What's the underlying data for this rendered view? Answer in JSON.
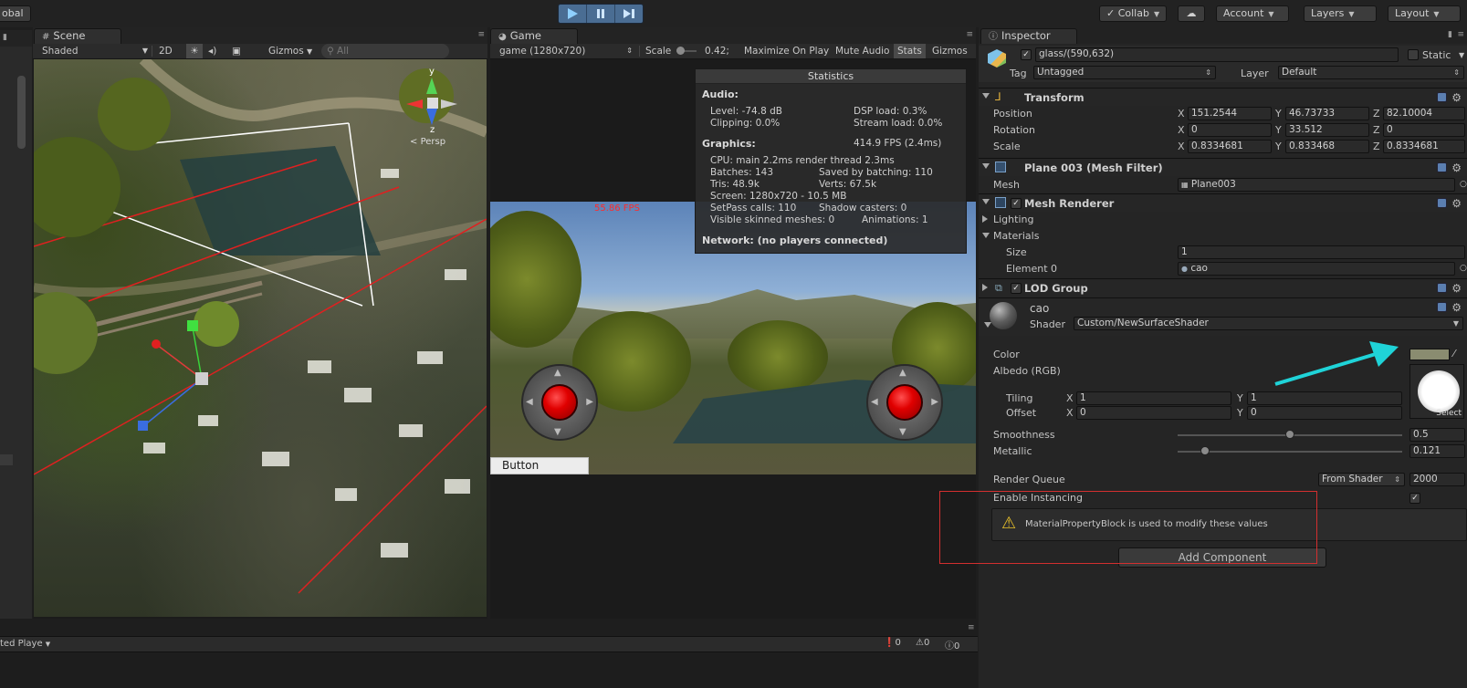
{
  "toolbar": {
    "left_fragment": "obal",
    "collab_label": "Collab",
    "account_label": "Account",
    "layers_label": "Layers",
    "layout_label": "Layout"
  },
  "scene": {
    "tab_label": "Scene",
    "shading_mode": "Shaded",
    "mode_2d": "2D",
    "gizmos_label": "Gizmos",
    "search_placeholder": "All",
    "gizmo_y": "y",
    "gizmo_z": "z",
    "gizmo_persp": "Persp"
  },
  "game": {
    "tab_label": "Game",
    "resolution": "game (1280x720)",
    "scale_label": "Scale",
    "scale_value": "0.42;",
    "maximize_on_play": "Maximize On Play",
    "mute_audio": "Mute Audio",
    "stats": "Stats",
    "gizmos": "Gizmos",
    "fps_overlay": "55.86 FPS",
    "button_label": "Button"
  },
  "statistics": {
    "title": "Statistics",
    "audio_heading": "Audio:",
    "level": "Level: -74.8 dB",
    "clipping": "Clipping: 0.0%",
    "dsp_load": "DSP load: 0.3%",
    "stream_load": "Stream load: 0.0%",
    "graphics_heading": "Graphics:",
    "fps": "414.9 FPS (2.4ms)",
    "cpu": "CPU: main 2.2ms  render thread 2.3ms",
    "batches": "Batches: 143",
    "saved_by_batching": "Saved by batching: 110",
    "tris": "Tris: 48.9k",
    "verts": "Verts: 67.5k",
    "screen": "Screen: 1280x720 - 10.5 MB",
    "setpass": "SetPass calls: 110",
    "shadow_casters": "Shadow casters: 0",
    "skinned_meshes": "Visible skinned meshes: 0",
    "animations": "Animations: 1",
    "network": "Network: (no players connected)"
  },
  "inspector": {
    "tab_label": "Inspector",
    "object_name": "glass/(590,632)",
    "static_label": "Static",
    "tag_label": "Tag",
    "tag_value": "Untagged",
    "layer_label": "Layer",
    "layer_value": "Default",
    "transform": {
      "title": "Transform",
      "position_label": "Position",
      "rotation_label": "Rotation",
      "scale_label": "Scale",
      "position": {
        "x": "151.2544",
        "y": "46.73733",
        "z": "82.10004"
      },
      "rotation": {
        "x": "0",
        "y": "33.512",
        "z": "0"
      },
      "scale": {
        "x": "0.8334681",
        "y": "0.833468",
        "z": "0.8334681"
      }
    },
    "mesh_filter": {
      "title": "Plane 003 (Mesh Filter)",
      "mesh_label": "Mesh",
      "mesh_value": "Plane003"
    },
    "mesh_renderer": {
      "title": "Mesh Renderer",
      "lighting": "Lighting",
      "materials": "Materials",
      "size_label": "Size",
      "size_value": "1",
      "element0_label": "Element 0",
      "element0_value": "cao"
    },
    "lod_group": {
      "title": "LOD Group"
    },
    "material": {
      "name": "cao",
      "shader_label": "Shader",
      "shader_value": "Custom/NewSurfaceShader",
      "color_label": "Color",
      "albedo_label": "Albedo (RGB)",
      "tiling_label": "Tiling",
      "offset_label": "Offset",
      "tiling": {
        "x": "1",
        "y": "1"
      },
      "offset": {
        "x": "0",
        "y": "0"
      },
      "select_label": "Select",
      "smoothness_label": "Smoothness",
      "smoothness_value": "0.5",
      "smoothness_fraction": 0.5,
      "metallic_label": "Metallic",
      "metallic_value": "0.121",
      "metallic_fraction": 0.121,
      "render_queue_label": "Render Queue",
      "render_queue_mode": "From Shader",
      "render_queue_value": "2000",
      "enable_instancing_label": "Enable Instancing",
      "warning": "MaterialPropertyBlock is used to modify these values"
    },
    "add_component": "Add Component"
  },
  "console": {
    "left_fragment": "ted Playe",
    "error_count": "0",
    "warning_count": "0",
    "log_count": "0"
  },
  "colors": {
    "play_accent": "#4a6d93",
    "annotation_arrow": "#1fd3d8",
    "highlight_box": "#d32f2f",
    "color_swatch": "#8a8c70"
  }
}
